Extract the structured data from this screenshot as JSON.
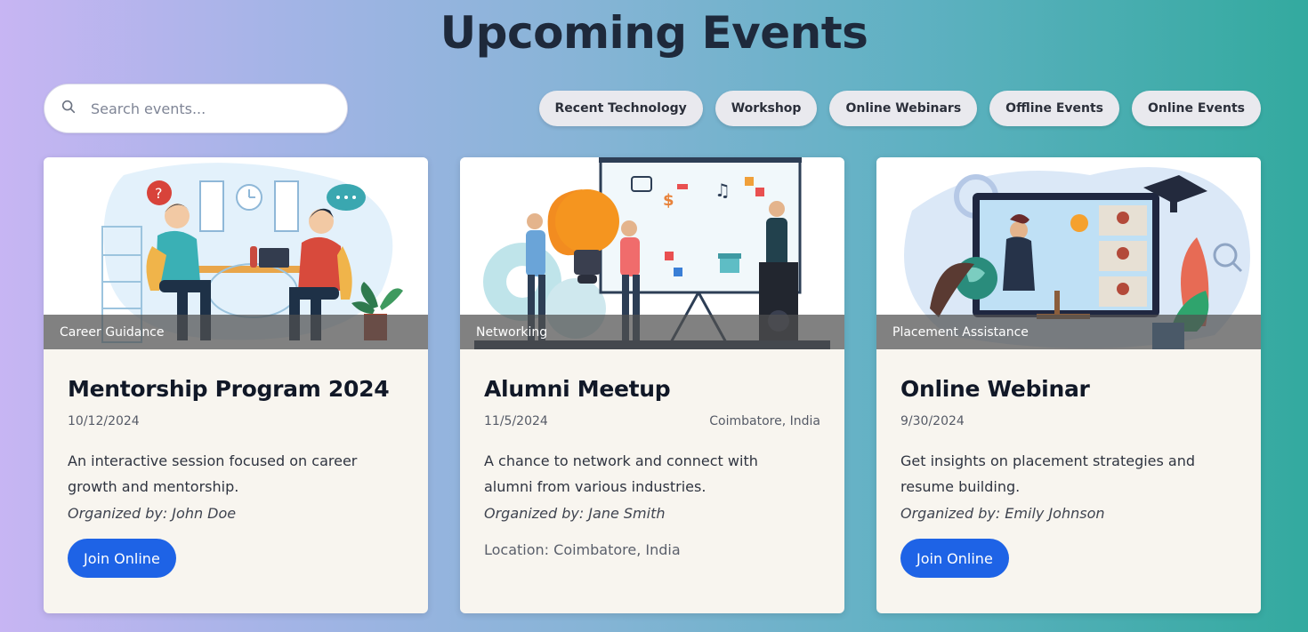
{
  "page": {
    "title": "Upcoming Events"
  },
  "search": {
    "placeholder": "Search events...",
    "icon": "search-icon"
  },
  "filters": [
    "Recent Technology",
    "Workshop",
    "Online Webinars",
    "Offline Events",
    "Online Events"
  ],
  "colors": {
    "accent": "#1e63e6",
    "title": "#1e293b",
    "card_bg": "#f8f5ef",
    "chip_bg": "#e9e9ee"
  },
  "events": [
    {
      "category": "Career Guidance",
      "title": "Mentorship Program 2024",
      "date": "10/12/2024",
      "venue": "",
      "description": "An interactive session focused on career growth and mentorship.",
      "organizer": "Organized by: John Doe",
      "action": "Join Online",
      "location": ""
    },
    {
      "category": "Networking",
      "title": "Alumni Meetup",
      "date": "11/5/2024",
      "venue": "Coimbatore, India",
      "description": "A chance to network and connect with alumni from various industries.",
      "organizer": "Organized by: Jane Smith",
      "action": "",
      "location": "Location: Coimbatore, India"
    },
    {
      "category": "Placement Assistance",
      "title": "Online Webinar",
      "date": "9/30/2024",
      "venue": "",
      "description": "Get insights on placement strategies and resume building.",
      "organizer": "Organized by: Emily Johnson",
      "action": "Join Online",
      "location": ""
    }
  ]
}
